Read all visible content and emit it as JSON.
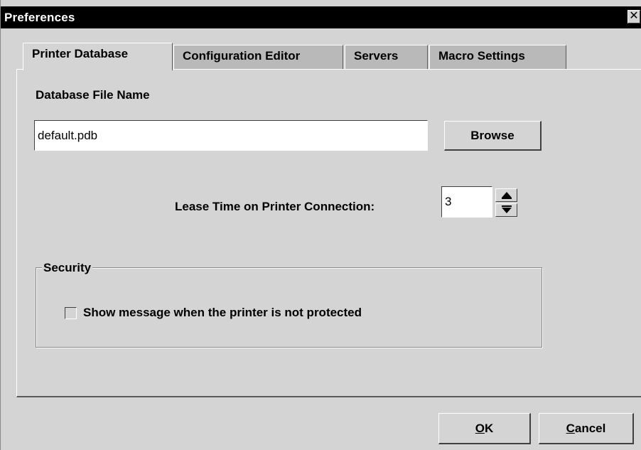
{
  "window": {
    "title": "Preferences",
    "close_label": "✕"
  },
  "tabs": [
    {
      "label": "Printer Database",
      "active": true
    },
    {
      "label": "Configuration Editor",
      "active": false
    },
    {
      "label": "Servers",
      "active": false
    },
    {
      "label": "Macro Settings",
      "active": false
    }
  ],
  "printer_database": {
    "db_file_label": "Database File Name",
    "db_file_value": "default.pdb",
    "browse_label": "Browse",
    "lease_label": "Lease Time on Printer Connection:",
    "lease_value": "3",
    "security_title": "Security",
    "show_message_label": "Show message when the printer is not protected",
    "show_message_checked": false
  },
  "footer": {
    "ok_label": "OK",
    "cancel_label": "Cancel"
  },
  "icons": {
    "close": "close-icon",
    "spin_up": "arrow-up-icon",
    "spin_down": "arrow-down-icon"
  },
  "colors": {
    "titlebar": "#000000",
    "dialog_bg": "#d4d4d4",
    "inactive_tab": "#b9b9b9"
  }
}
